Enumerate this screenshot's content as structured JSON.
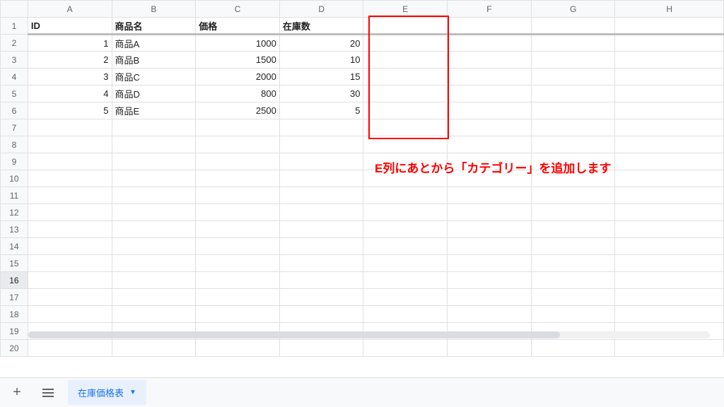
{
  "columns": [
    "A",
    "B",
    "C",
    "D",
    "E",
    "F",
    "G",
    "H"
  ],
  "row_count": 20,
  "selected_row": 16,
  "headers": {
    "A": "ID",
    "B": "商品名",
    "C": "価格",
    "D": "在庫数"
  },
  "rows": [
    {
      "id": "1",
      "name": "商品A",
      "price": "1000",
      "stock": "20"
    },
    {
      "id": "2",
      "name": "商品B",
      "price": "1500",
      "stock": "10"
    },
    {
      "id": "3",
      "name": "商品C",
      "price": "2000",
      "stock": "15"
    },
    {
      "id": "4",
      "name": "商品D",
      "price": "800",
      "stock": "30"
    },
    {
      "id": "5",
      "name": "商品E",
      "price": "2500",
      "stock": "5"
    }
  ],
  "annotation": "E列にあとから「カテゴリー」を追加します",
  "sheet_tab": "在庫価格表",
  "chart_data": {
    "type": "table",
    "title": "在庫価格表",
    "columns": [
      "ID",
      "商品名",
      "価格",
      "在庫数"
    ],
    "data": [
      [
        1,
        "商品A",
        1000,
        20
      ],
      [
        2,
        "商品B",
        1500,
        10
      ],
      [
        3,
        "商品C",
        2000,
        15
      ],
      [
        4,
        "商品D",
        800,
        30
      ],
      [
        5,
        "商品E",
        2500,
        5
      ]
    ]
  }
}
